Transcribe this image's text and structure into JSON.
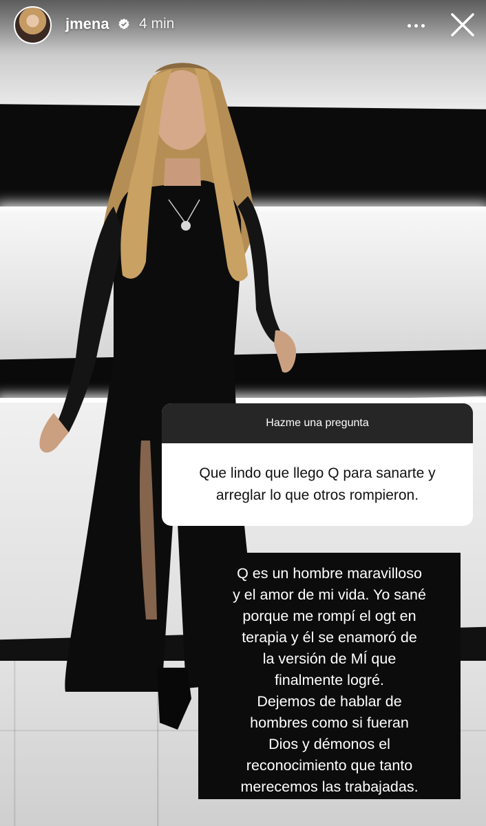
{
  "story": {
    "username": "jmena",
    "verified": true,
    "time_ago": "4 min",
    "more_icon": "more-horizontal-icon",
    "close_icon": "close-icon"
  },
  "question_sticker": {
    "header": "Hazme una pregunta",
    "question": "Que lindo que llego Q para sanarte y arreglar lo que otros rompieron."
  },
  "answer": {
    "lines": [
      "Q es un hombre maravilloso",
      "y el amor de mi vida. Yo sané",
      "porque me rompí el ogt en",
      "terapia y él se enamoró de",
      "la versión de MÍ que",
      "finalmente logré.",
      "Dejemos de hablar de",
      "hombres como si fueran",
      "Dios y démonos el",
      "reconocimiento que tanto",
      "merecemos las trabajadas."
    ]
  },
  "colors": {
    "sticker_header": "#262626",
    "answer_background": "#0c0c0c",
    "text_light": "#ffffff"
  }
}
